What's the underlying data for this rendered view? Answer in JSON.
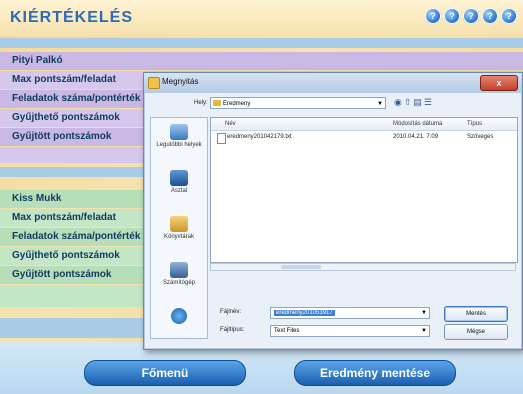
{
  "app": {
    "title": "KIÉRTÉKELÉS",
    "controls": [
      "?",
      "?",
      "?",
      "?",
      "?"
    ]
  },
  "players": [
    {
      "name": "Pityi Palkó",
      "rows": [
        "Max pontszám/feladat",
        "Feladatok száma/pontérték",
        "Gyűjthető pontszámok",
        "Gyűjtött pontszámok"
      ]
    },
    {
      "name": "Kiss Mukk",
      "rows": [
        "Max pontszám/feladat",
        "Feladatok száma/pontérték",
        "Gyűjthető pontszámok",
        "Gyűjtött pontszámok"
      ]
    }
  ],
  "buttons": {
    "main_menu": "Főmenü",
    "save_result": "Eredmény mentése"
  },
  "dialog": {
    "title": "Megnyitás",
    "close": "x",
    "look_in_label": "Hely:",
    "look_in_value": "Eredmeny",
    "places": [
      "Legutóbbi helyek",
      "Asztal",
      "Könyvtárak",
      "Számítógép",
      ""
    ],
    "columns": [
      "Név",
      "Módosítás dátuma",
      "Típus"
    ],
    "files": [
      {
        "name": "eredmeny201042179.txt",
        "date": "2010.04.21. 7:09",
        "type": "Szöveges"
      }
    ],
    "filename_label": "Fájlnév:",
    "filename_value": "eredmeny201053917",
    "filetype_label": "Fájltípus:",
    "filetype_value": "Text Files",
    "save_button": "Mentés",
    "cancel_button": "Mégse"
  }
}
